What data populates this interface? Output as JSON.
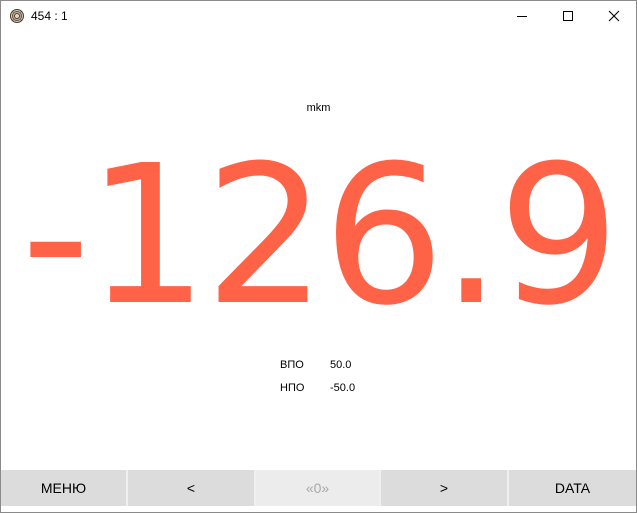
{
  "window": {
    "title": "454 : 1"
  },
  "display": {
    "unit": "mkm",
    "value": "-126.9",
    "value_color": "#ff6347"
  },
  "limits": {
    "upper_label": "ВПО",
    "upper_value": "50.0",
    "lower_label": "НПО",
    "lower_value": "-50.0"
  },
  "buttons": {
    "menu": "МЕНЮ",
    "prev": "<",
    "zero": "«0»",
    "next": ">",
    "data": "DATA"
  }
}
